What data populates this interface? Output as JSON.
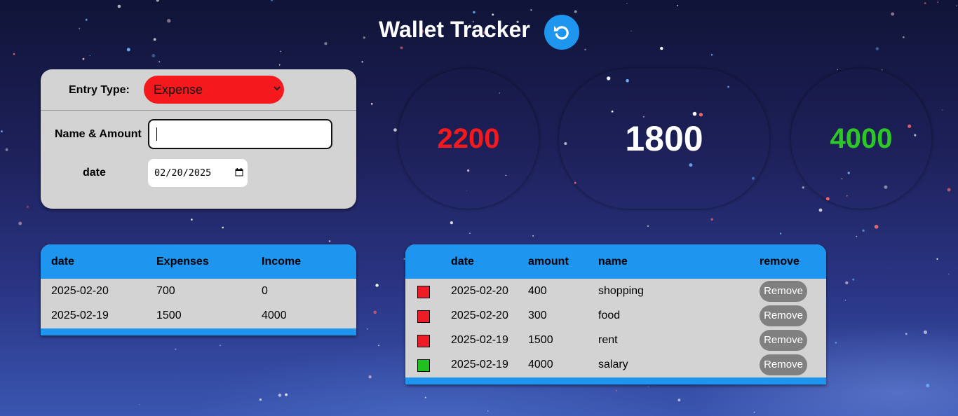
{
  "header": {
    "title": "Wallet Tracker",
    "refresh_icon": "refresh-icon"
  },
  "form": {
    "entry_type_label": "Entry Type:",
    "entry_type_value": "Expense",
    "entry_type_color": "#f5191e",
    "name_amount_label": "Name & Amount",
    "name_amount_value": "",
    "date_label": "date",
    "date_value": "02/20/2025"
  },
  "summary": {
    "expenses": "2200",
    "balance": "1800",
    "income": "4000",
    "expense_color": "#f5191e",
    "income_color": "#2dc825"
  },
  "daily_table": {
    "columns": [
      "date",
      "Expenses",
      "Income"
    ],
    "rows": [
      [
        "2025-02-20",
        "700",
        "0"
      ],
      [
        "2025-02-19",
        "1500",
        "4000"
      ]
    ]
  },
  "entries_table": {
    "columns": [
      "date",
      "amount",
      "name",
      "remove"
    ],
    "remove_label": "Remove",
    "rows": [
      {
        "type": "expense",
        "color": "#ee1c25",
        "date": "2025-02-20",
        "amount": "400",
        "name": "shopping"
      },
      {
        "type": "expense",
        "color": "#ee1c25",
        "date": "2025-02-20",
        "amount": "300",
        "name": "food"
      },
      {
        "type": "expense",
        "color": "#ee1c25",
        "date": "2025-02-19",
        "amount": "1500",
        "name": "rent"
      },
      {
        "type": "income",
        "color": "#20c020",
        "date": "2025-02-19",
        "amount": "4000",
        "name": "salary"
      }
    ]
  },
  "accent_color": "#1e96f0"
}
